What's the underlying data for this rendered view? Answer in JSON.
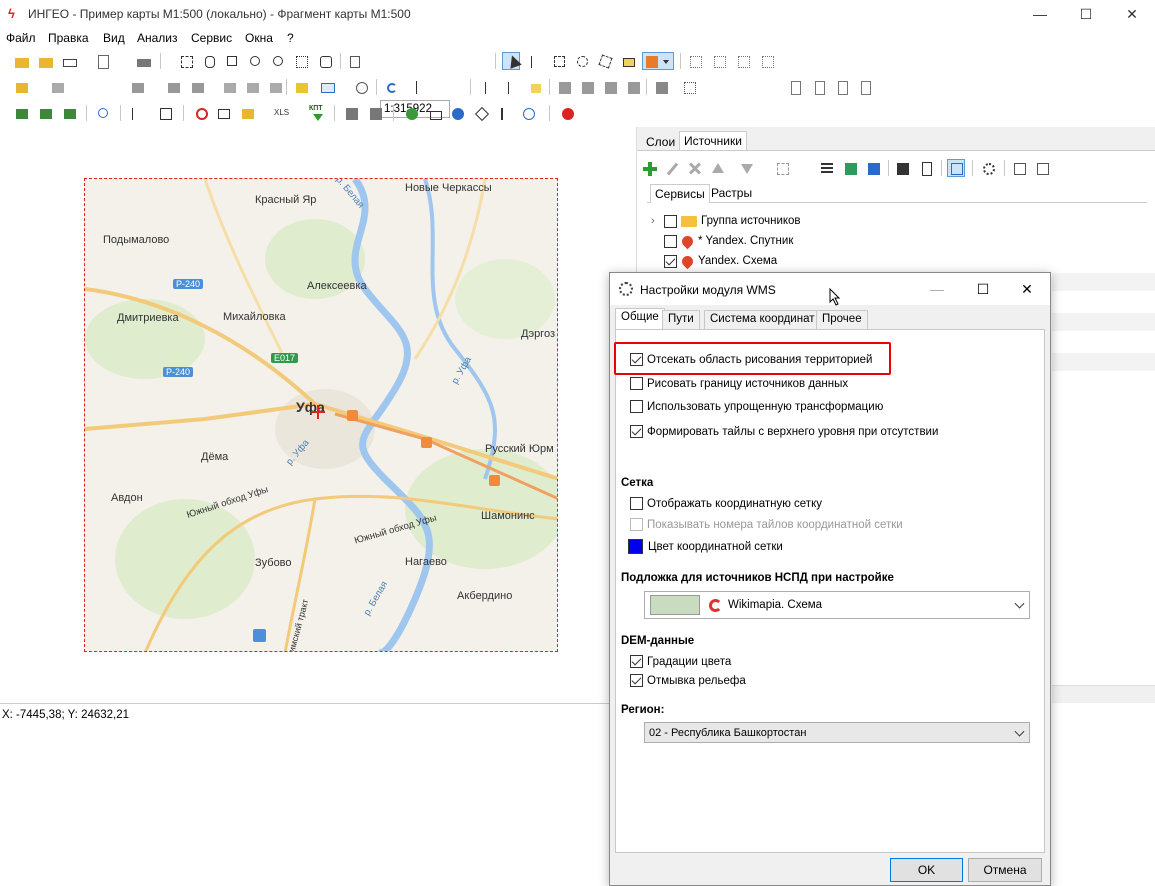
{
  "app": {
    "title": "ИНГЕО - Пример карты М1:500 (локально) - Фрагмент карты М1:500"
  },
  "menu": [
    "Файл",
    "Правка",
    "Вид",
    "Анализ",
    "Сервис",
    "Окна",
    "?"
  ],
  "toolbar": {
    "scale_value": "1:315922",
    "xls_label": "XLS",
    "kpt_label": "КПТ"
  },
  "map": {
    "labels": [
      "Новые Черкассы",
      "Красный Яр",
      "Подымалово",
      "Р-240",
      "Алексеевка",
      "Дмитриевка",
      "Михайловка",
      "Дэргоз",
      "E017",
      "Р-240",
      "Уфа",
      "Дёма",
      "Русский Юрм",
      "Авдон",
      "Южный обход Уфы",
      "Южный обход Уфы",
      "Шамонинс",
      "Зубово",
      "Нагаево",
      "Акбердино",
      "р. Белая",
      "р. Белая",
      "р. Уфа",
      "р. Уфа",
      "Уфимский тракт"
    ]
  },
  "status": {
    "coords": "X: -7445,38; Y: 24632,21"
  },
  "right_panel": {
    "tabs": [
      "Слои",
      "Источники"
    ],
    "subtabs": [
      "Сервисы",
      "Растры"
    ],
    "tree": [
      {
        "label": "Группа источников",
        "checked": false
      },
      {
        "label": "* Yandex. Спутник",
        "checked": false
      },
      {
        "label": "Yandex. Схема",
        "checked": true
      }
    ]
  },
  "dialog": {
    "title": "Настройки модуля WMS",
    "tabs": [
      "Общие",
      "Пути",
      "Система координат",
      "Прочее"
    ],
    "options": [
      {
        "label": "Отсекать область рисования территорией",
        "checked": true
      },
      {
        "label": "Рисовать границу источников данных",
        "checked": false
      },
      {
        "label": "Использовать упрощенную трансформацию",
        "checked": false
      },
      {
        "label": "Формировать тайлы с верхнего уровня при отсутствии",
        "checked": true
      }
    ],
    "grid_section": "Сетка",
    "grid_options": [
      {
        "label": "Отображать координатную сетку",
        "checked": false
      },
      {
        "label": "Показывать номера тайлов координатной сетки",
        "checked": false,
        "disabled": true
      }
    ],
    "grid_color_label": "Цвет координатной сетки",
    "grid_color": "#0000ee",
    "substrate_section": "Подложка для источников  НСПД  при настройке",
    "substrate_value": "Wikimapia. Схема",
    "dem_section": "DEM-данные",
    "dem_options": [
      {
        "label": "Градации цвета",
        "checked": true
      },
      {
        "label": "Отмывка рельефа",
        "checked": true
      }
    ],
    "region_section": "Регион:",
    "region_value": "02 - Республика Башкортостан",
    "ok": "OK",
    "cancel": "Отмена"
  },
  "colors": {
    "highlight": "#e00000",
    "accent_blue": "#0078d7"
  }
}
